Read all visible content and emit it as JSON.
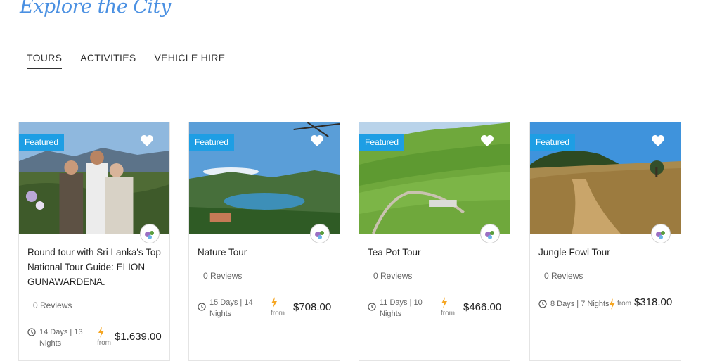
{
  "header": {
    "logo_text": "Explore the City"
  },
  "nav": {
    "tabs": [
      {
        "label": "TOURS",
        "active": true
      },
      {
        "label": "ACTIVITIES",
        "active": false
      },
      {
        "label": "VEHICLE HIRE",
        "active": false
      }
    ]
  },
  "cards": [
    {
      "badge": "Featured",
      "title": "Round tour with Sri Lanka's Top National Tour Guide: ELION GUNAWARDENA.",
      "reviews": "0 Reviews",
      "duration": "14 Days | 13 Nights",
      "from": "from",
      "price": "$1.639.00"
    },
    {
      "badge": "Featured",
      "title": "Nature Tour",
      "reviews": "0 Reviews",
      "duration": "15 Days | 14 Nights",
      "from": "from",
      "price": "$708.00"
    },
    {
      "badge": "Featured",
      "title": "Tea Pot Tour",
      "reviews": "0 Reviews",
      "duration": "11 Days | 10 Nights",
      "from": "from",
      "price": "$466.00"
    },
    {
      "badge": "Featured",
      "title": "Jungle Fowl Tour",
      "reviews": "0 Reviews",
      "duration": "8 Days | 7 Nights",
      "from": "from",
      "price": "$318.00"
    }
  ],
  "colors": {
    "accent": "#1e9ee4",
    "bolt": "#f5a623",
    "logo": "#4a90e2"
  },
  "icons": {
    "favorite": "heart-icon",
    "duration": "clock-icon",
    "price": "bolt-icon"
  }
}
